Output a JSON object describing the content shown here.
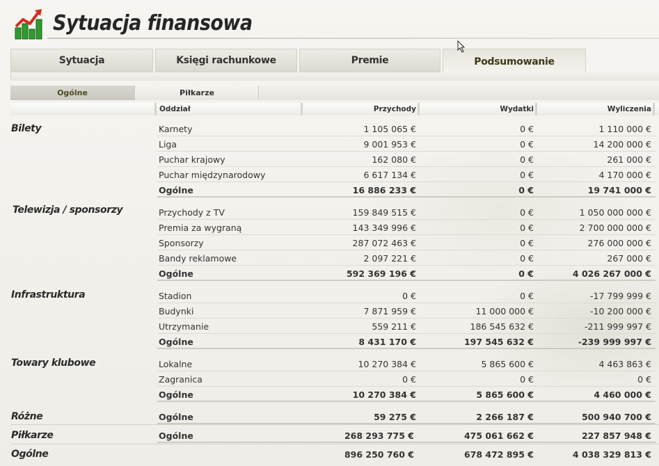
{
  "header": {
    "title": "Sytuacja finansowa"
  },
  "tabs": [
    {
      "label": "Sytuacja",
      "active": false
    },
    {
      "label": "Księgi rachunkowe",
      "active": false
    },
    {
      "label": "Premie",
      "active": false
    },
    {
      "label": "Podsumowanie",
      "active": true
    }
  ],
  "subtabs": [
    {
      "label": "Ogólne",
      "active": true
    },
    {
      "label": "Piłkarze",
      "active": false
    }
  ],
  "columns": {
    "dept": "Oddział",
    "income": "Przychody",
    "expense": "Wydatki",
    "calc": "Wyliczenia"
  },
  "sections": [
    {
      "category": "Bilety",
      "rows": [
        {
          "label": "Karnety",
          "income": "1 105 065 €",
          "expense": "0 €",
          "calc": "1 110 000 €"
        },
        {
          "label": "Liga",
          "income": "9 001 953 €",
          "expense": "0 €",
          "calc": "14 200 000 €"
        },
        {
          "label": "Puchar krajowy",
          "income": "162 080 €",
          "expense": "0 €",
          "calc": "261 000 €"
        },
        {
          "label": "Puchar międzynarodowy",
          "income": "6 617 134 €",
          "expense": "0 €",
          "calc": "4 170 000 €"
        }
      ],
      "total": {
        "label": "Ogólne",
        "income": "16 886 233 €",
        "expense": "0 €",
        "calc": "19 741 000 €"
      }
    },
    {
      "category": "Telewizja / sponsorzy",
      "rows": [
        {
          "label": "Przychody z TV",
          "income": "159 849 515 €",
          "expense": "0 €",
          "calc": "1 050 000 000 €"
        },
        {
          "label": "Premia za wygraną",
          "income": "143 349 996 €",
          "expense": "0 €",
          "calc": "2 700 000 000 €"
        },
        {
          "label": "Sponsorzy",
          "income": "287 072 463 €",
          "expense": "0 €",
          "calc": "276 000 000 €"
        },
        {
          "label": "Bandy reklamowe",
          "income": "2 097 221 €",
          "expense": "0 €",
          "calc": "267 000 €"
        }
      ],
      "total": {
        "label": "Ogólne",
        "income": "592 369 196 €",
        "expense": "0 €",
        "calc": "4 026 267 000 €"
      }
    },
    {
      "category": "Infrastruktura",
      "rows": [
        {
          "label": "Stadion",
          "income": "0 €",
          "expense": "0 €",
          "calc": "-17 799 999 €"
        },
        {
          "label": "Budynki",
          "income": "7 871 959 €",
          "expense": "11 000 000 €",
          "calc": "-10 200 000 €"
        },
        {
          "label": "Utrzymanie",
          "income": "559 211 €",
          "expense": "186 545 632 €",
          "calc": "-211 999 997 €"
        }
      ],
      "total": {
        "label": "Ogólne",
        "income": "8 431 170 €",
        "expense": "197 545 632 €",
        "calc": "-239 999 997 €"
      }
    },
    {
      "category": "Towary klubowe",
      "rows": [
        {
          "label": "Lokalne",
          "income": "10 270 384 €",
          "expense": "5 865 600 €",
          "calc": "4 463 863 €"
        },
        {
          "label": "Zagranica",
          "income": "0 €",
          "expense": "0 €",
          "calc": "0 €"
        }
      ],
      "total": {
        "label": "Ogólne",
        "income": "10 270 384 €",
        "expense": "5 865 600 €",
        "calc": "4 460 000 €"
      }
    }
  ],
  "misc": [
    {
      "category": "Różne",
      "label": "Ogólne",
      "income": "59 275 €",
      "expense": "2 266 187 €",
      "calc": "500 940 700 €"
    },
    {
      "category": "Piłkarze",
      "label": "Ogólne",
      "income": "268 293 775 €",
      "expense": "475 061 662 €",
      "calc": "227 857 948 €"
    }
  ],
  "grand": {
    "category": "Ogólne",
    "income": "896 250 760 €",
    "expense": "678 472 895 €",
    "calc": "4 038 329 813 €"
  },
  "colors": {
    "accent_text": "#4d4a1f",
    "logo_green": "#2f9b2f",
    "logo_red": "#d62a1f"
  }
}
